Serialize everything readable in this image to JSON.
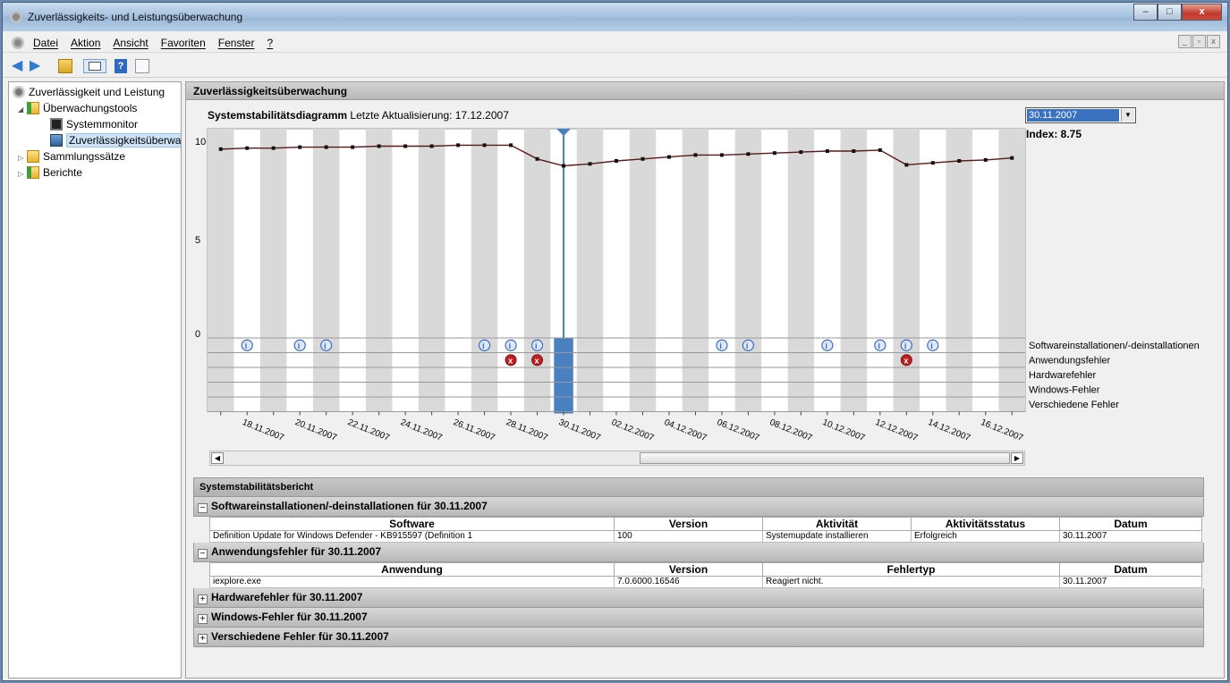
{
  "window": {
    "title": "Zuverlässigkeits- und Leistungsüberwachung",
    "controls": {
      "minimize": "–",
      "maximize": "□",
      "close": "x"
    }
  },
  "menu": {
    "items": [
      "Datei",
      "Aktion",
      "Ansicht",
      "Favoriten",
      "Fenster",
      "?"
    ],
    "mdi": [
      "_",
      "▫",
      "x"
    ]
  },
  "toolbar": {
    "icons": [
      "back-arrow-icon",
      "forward-arrow-icon",
      "up-folder-icon",
      "show-tree-icon",
      "help-icon",
      "view-icon"
    ]
  },
  "tree": {
    "root": "Zuverlässigkeit und Leistung",
    "monitoring_tools": "Überwachungstools",
    "system_monitor": "Systemmonitor",
    "reliability_monitor": "Zuverlässigkeitsüberwa",
    "collector_sets": "Sammlungssätze",
    "reports": "Berichte"
  },
  "main": {
    "header": "Zuverlässigkeitsüberwachung",
    "chart_title_bold": "Systemstabilitätsdiagramm",
    "last_update": "Letzte Aktualisierung: 17.12.2007",
    "selected_date": "30.11.2007",
    "index": "Index: 8.75"
  },
  "chart_data": {
    "type": "line",
    "title": "Systemstabilitätsdiagramm",
    "ylim": [
      0,
      10
    ],
    "yticks": [
      "10",
      "5",
      "0"
    ],
    "x": [
      "17.11.2007",
      "18.11.2007",
      "19.11.2007",
      "20.11.2007",
      "21.11.2007",
      "22.11.2007",
      "23.11.2007",
      "24.11.2007",
      "25.11.2007",
      "26.11.2007",
      "27.11.2007",
      "28.11.2007",
      "29.11.2007",
      "30.11.2007",
      "01.12.2007",
      "02.12.2007",
      "03.12.2007",
      "04.12.2007",
      "05.12.2007",
      "06.12.2007",
      "07.12.2007",
      "08.12.2007",
      "09.12.2007",
      "10.12.2007",
      "11.12.2007",
      "12.12.2007",
      "13.12.2007",
      "14.12.2007",
      "15.12.2007",
      "16.12.2007",
      "17.12.2007"
    ],
    "xtick_labels": [
      "18.11.2007",
      "20.11.2007",
      "22.11.2007",
      "24.11.2007",
      "26.11.2007",
      "28.11.2007",
      "30.11.2007",
      "02.12.2007",
      "04.12.2007",
      "06.12.2007",
      "08.12.2007",
      "10.12.2007",
      "12.12.2007",
      "14.12.2007",
      "16.12.2007"
    ],
    "series": [
      {
        "values": [
          9.6,
          9.65,
          9.65,
          9.7,
          9.7,
          9.7,
          9.75,
          9.75,
          9.75,
          9.8,
          9.8,
          9.8,
          9.1,
          8.75,
          8.85,
          9.0,
          9.1,
          9.2,
          9.3,
          9.3,
          9.35,
          9.4,
          9.45,
          9.5,
          9.5,
          9.55,
          8.8,
          8.9,
          9.0,
          9.05,
          9.15
        ]
      }
    ],
    "event_rows": [
      "Softwareinstallationen/-deinstallationen",
      "Anwendungsfehler",
      "Hardwarefehler",
      "Windows-Fehler",
      "Verschiedene Fehler"
    ],
    "events": {
      "software": [
        "18.11.2007",
        "20.11.2007",
        "21.11.2007",
        "27.11.2007",
        "28.11.2007",
        "29.11.2007",
        "06.12.2007",
        "07.12.2007",
        "10.12.2007",
        "12.12.2007",
        "13.12.2007",
        "14.12.2007"
      ],
      "application_errors": [
        "28.11.2007",
        "29.11.2007",
        "13.12.2007"
      ]
    },
    "selected": "30.11.2007"
  },
  "report": {
    "title": "Systemstabilitätsbericht",
    "software_section": "Softwareinstallationen/-deinstallationen für 30.11.2007",
    "software_columns": [
      "Software",
      "Version",
      "Aktivität",
      "Aktivitätsstatus",
      "Datum"
    ],
    "software_rows": [
      [
        "Definition Update for Windows Defender - KB915597 (Definition 1",
        "100",
        "Systemupdate installieren",
        "Erfolgreich",
        "30.11.2007"
      ]
    ],
    "app_section": "Anwendungsfehler für 30.11.2007",
    "app_columns": [
      "Anwendung",
      "Version",
      "Fehlertyp",
      "Datum"
    ],
    "app_rows": [
      [
        "iexplore.exe",
        "7.0.6000.16546",
        "Reagiert nicht.",
        "30.11.2007"
      ]
    ],
    "hardware_section": "Hardwarefehler für 30.11.2007",
    "windows_section": "Windows-Fehler für 30.11.2007",
    "misc_section": "Verschiedene Fehler für 30.11.2007",
    "collapse": "−",
    "expand": "+"
  },
  "colors": {
    "selection": "#4a7fc0",
    "line": "#5a1a1a",
    "stripe": "#d9d9d9",
    "error": "#c02020",
    "info": "#3a6cc0"
  }
}
